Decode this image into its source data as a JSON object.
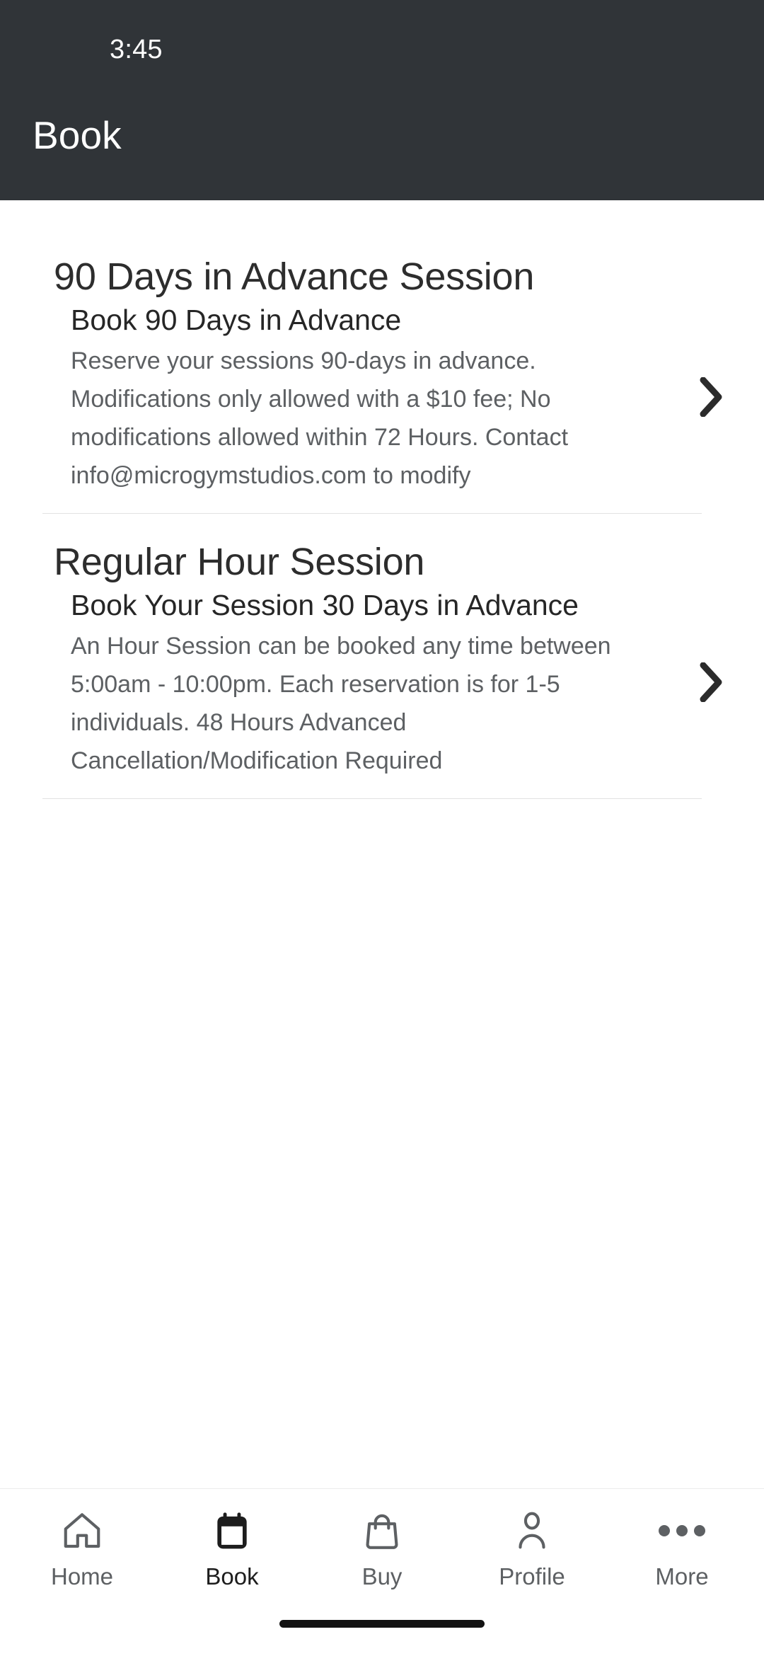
{
  "status_bar": {
    "time": "3:45"
  },
  "app_bar": {
    "title": "Book"
  },
  "sections": [
    {
      "heading": "90 Days in Advance Session",
      "items": [
        {
          "title": "Book 90 Days in Advance",
          "description": "Reserve your sessions 90-days in advance. Modifications only allowed with a $10 fee; No modifications allowed within 72 Hours. Contact info@microgymstudios.com to modify",
          "chevron_icon": "chevron-right-icon"
        }
      ]
    },
    {
      "heading": "Regular Hour Session",
      "items": [
        {
          "title": "Book Your Session 30 Days in Advance",
          "description": "An Hour Session can be booked any time between 5:00am - 10:00pm. Each reservation is for 1-5 individuals. 48 Hours Advanced Cancellation/Modification Required",
          "chevron_icon": "chevron-right-icon"
        }
      ]
    }
  ],
  "bottom_nav": {
    "items": [
      {
        "label": "Home",
        "icon": "home-icon",
        "active": false
      },
      {
        "label": "Book",
        "icon": "calendar-icon",
        "active": true
      },
      {
        "label": "Buy",
        "icon": "shopping-bag-icon",
        "active": false
      },
      {
        "label": "Profile",
        "icon": "person-icon",
        "active": false
      },
      {
        "label": "More",
        "icon": "more-dots-icon",
        "active": false
      }
    ]
  },
  "colors": {
    "appbar_background": "#303438",
    "page_background": "#ffffff",
    "title_text": "#262626",
    "body_text": "#5d6063",
    "divider": "#e2e2e2",
    "active_nav": "#1d1d1d",
    "home_indicator": "#121212"
  }
}
